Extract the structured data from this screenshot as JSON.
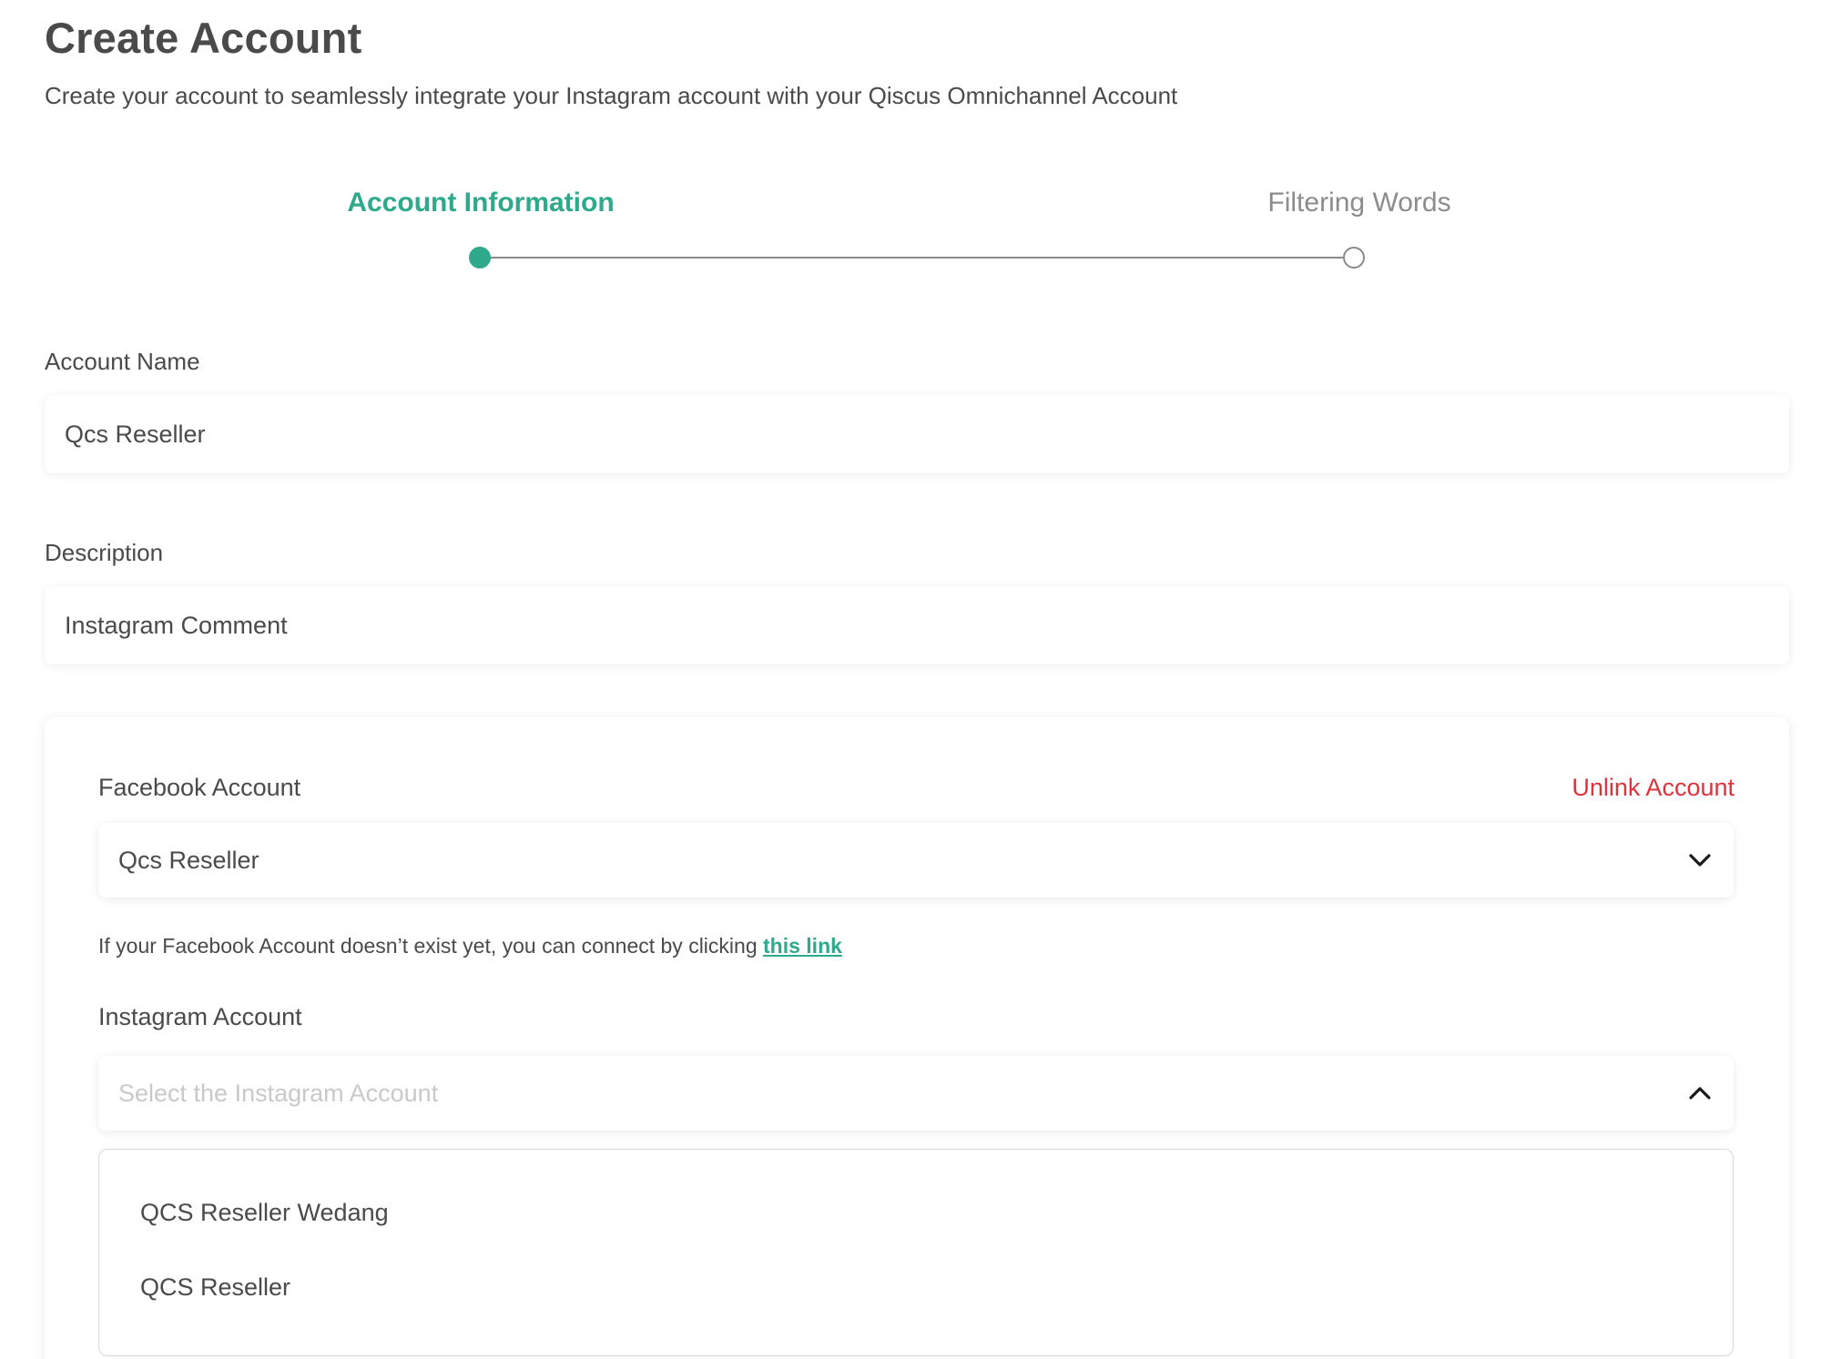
{
  "header": {
    "title": "Create Account",
    "subtitle": "Create your account to seamlessly integrate your Instagram account with your Qiscus Omnichannel Account"
  },
  "stepper": {
    "steps": [
      {
        "label": "Account Information",
        "state": "active"
      },
      {
        "label": "Filtering Words",
        "state": "inactive"
      }
    ],
    "accent_color": "#2fa98c"
  },
  "form": {
    "account_name": {
      "label": "Account Name",
      "value": "Qcs Reseller"
    },
    "description": {
      "label": "Description",
      "value": "Instagram Comment"
    }
  },
  "connection": {
    "facebook": {
      "label": "Facebook Account",
      "unlink_label": "Unlink Account",
      "selected": "Qcs Reseller",
      "hint_text": "If your Facebook Account doesn’t exist yet, you can connect by clicking ",
      "hint_link": "this link"
    },
    "instagram": {
      "label": "Instagram Account",
      "placeholder": "Select the Instagram Account",
      "options": [
        "QCS Reseller Wedang",
        "QCS Reseller"
      ]
    },
    "danger_color": "#e0323a"
  },
  "icons": {
    "facebook_select": "chevron-down-icon",
    "instagram_select": "chevron-up-icon"
  }
}
